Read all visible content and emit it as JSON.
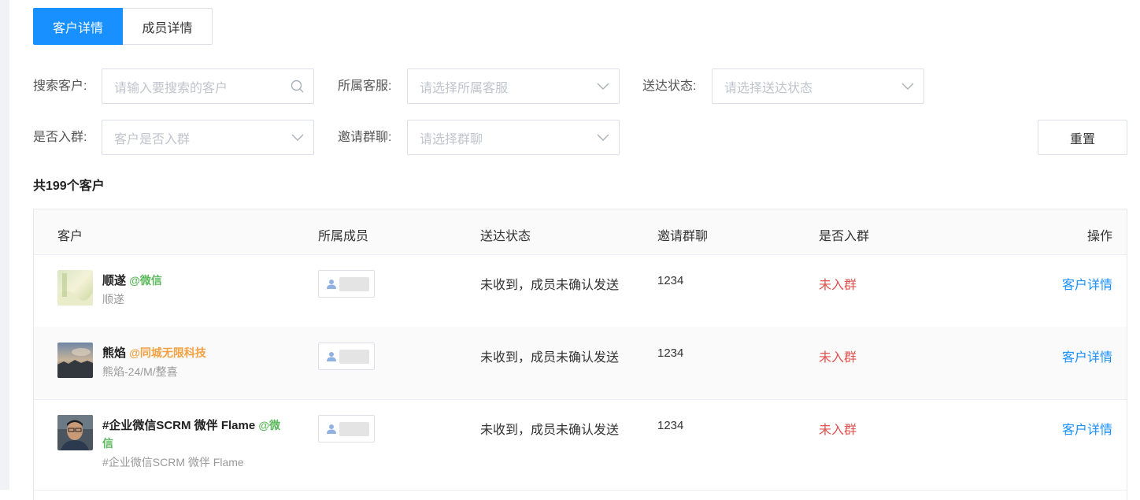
{
  "tabs": [
    {
      "label": "客户详情",
      "active": true
    },
    {
      "label": "成员详情",
      "active": false
    }
  ],
  "filters": {
    "search": {
      "label": "搜索客户:",
      "placeholder": "请输入要搜索的客户",
      "icon": "search-icon"
    },
    "service": {
      "label": "所属客服:",
      "placeholder": "请选择所属客服",
      "icon": "chevron-down-icon"
    },
    "delivery": {
      "label": "送达状态:",
      "placeholder": "请选择送达状态",
      "icon": "chevron-down-icon"
    },
    "joined": {
      "label": "是否入群:",
      "placeholder": "客户是否入群",
      "icon": "chevron-down-icon"
    },
    "group": {
      "label": "邀请群聊:",
      "placeholder": "请选择群聊",
      "icon": "chevron-down-icon"
    },
    "reset_label": "重置"
  },
  "summary": "共199个客户",
  "table": {
    "headers": [
      "客户",
      "所属成员",
      "送达状态",
      "邀请群聊",
      "是否入群",
      "操作"
    ],
    "rows": [
      {
        "name": "顺遂",
        "corp": "@微信",
        "corp_color": "#5cb85c",
        "remark": "顺遂",
        "member_icon": "user-icon",
        "delivery": "未收到，成员未确认发送",
        "group": "1234",
        "joined": "未入群",
        "action": "客户详情"
      },
      {
        "name": "熊焰",
        "corp": "@同城无限科技",
        "corp_color": "#f0a142",
        "remark": "熊焰-24/M/整喜",
        "member_icon": "user-icon",
        "delivery": "未收到，成员未确认发送",
        "group": "1234",
        "joined": "未入群",
        "action": "客户详情"
      },
      {
        "name": "#企业微信SCRM 微伴 Flame",
        "corp": "@微信",
        "corp_color": "#5cb85c",
        "remark": "#企业微信SCRM 微伴 Flame",
        "member_icon": "user-icon",
        "delivery": "未收到，成员未确认发送",
        "group": "1234",
        "joined": "未入群",
        "action": "客户详情"
      }
    ]
  },
  "colors": {
    "primary": "#1890ff",
    "danger": "#e0524f",
    "placeholder": "#c0c4cc",
    "border": "#dcdfe6"
  }
}
